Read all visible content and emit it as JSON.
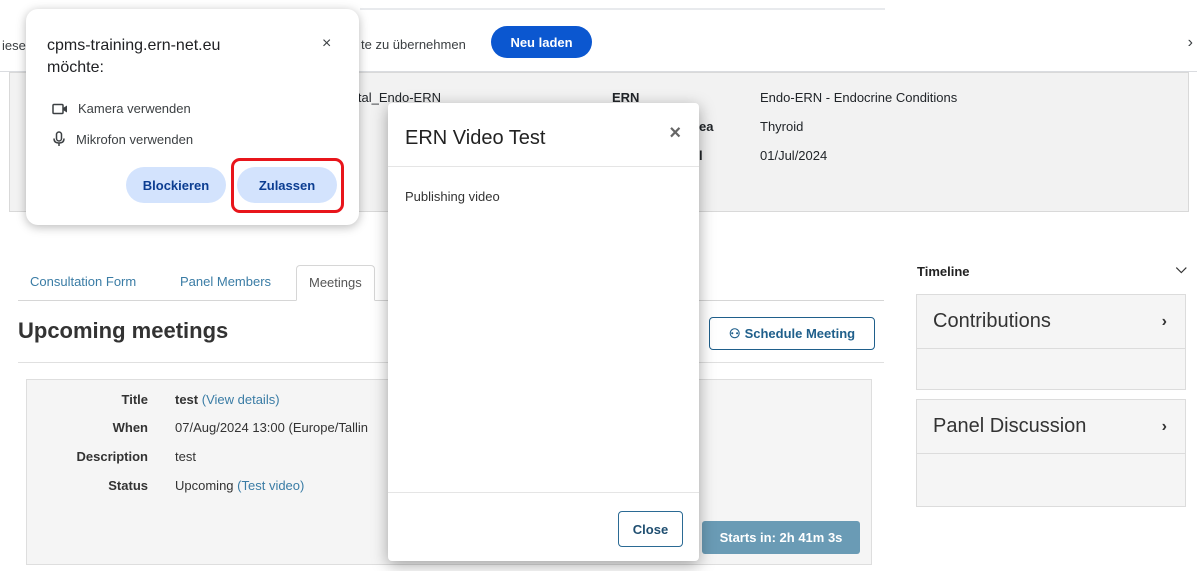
{
  "infobar": {
    "truncated_left": "iese",
    "message": "te zu übernehmen",
    "reload_label": "Neu laden",
    "chevron": "›"
  },
  "case_info": {
    "left_value": "ital_Endo-ERN",
    "ern_label": "ERN",
    "ern_value": "Endo-ERN - Endocrine Conditions",
    "area_label_partial": "ea",
    "area_value": "Thyroid",
    "date_label_partial": "l",
    "date_value": "01/Jul/2024"
  },
  "tabs": [
    {
      "label": "Consultation Form"
    },
    {
      "label": "Panel Members"
    },
    {
      "label": "Meetings"
    }
  ],
  "meetings": {
    "heading": "Upcoming meetings",
    "schedule_label": "Schedule Meeting",
    "title_label": "Title",
    "title_value": "test",
    "title_link": "(View details)",
    "when_label": "When",
    "when_value": "07/Aug/2024 13:00 (Europe/Tallin",
    "description_label": "Description",
    "description_value": "test",
    "status_label": "Status",
    "status_value": "Upcoming",
    "status_link": "(Test video)",
    "starts_in": "Starts in: 2h 41m 3s"
  },
  "sidebar": {
    "timeline_label": "Timeline",
    "toggle": "»",
    "contributions": "Contributions",
    "panel_discussion": "Panel Discussion",
    "arrow": "›"
  },
  "permission": {
    "title_line1": "cpms-training.ern-net.eu",
    "title_line2": "möchte:",
    "close": "×",
    "camera": "Kamera verwenden",
    "microphone": "Mikrofon verwenden",
    "block_label": "Blockieren",
    "allow_label": "Zulassen"
  },
  "modal": {
    "title": "ERN Video Test",
    "close_x": "×",
    "body": "Publishing video",
    "close_label": "Close"
  },
  "colors": {
    "accent": "#0b57d0",
    "highlight": "#e8151b",
    "link": "#3a7ca5"
  }
}
